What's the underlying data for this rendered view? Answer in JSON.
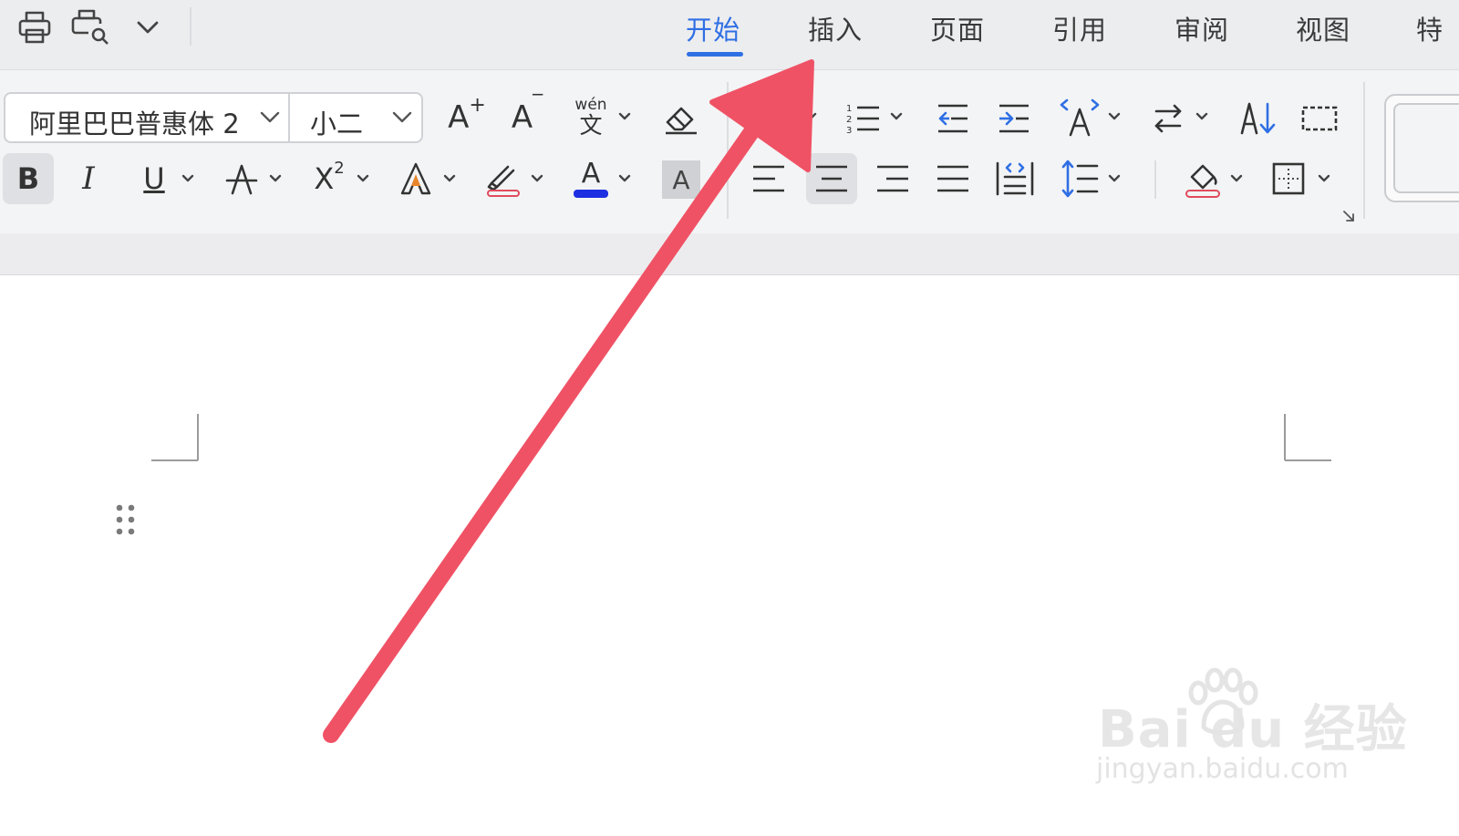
{
  "quick_access": {
    "print_icon": "printer-icon",
    "preview_icon": "print-preview-icon",
    "more_icon": "chevron-down-icon"
  },
  "tabs": [
    {
      "label": "开始",
      "active": true
    },
    {
      "label": "插入",
      "active": false
    },
    {
      "label": "页面",
      "active": false
    },
    {
      "label": "引用",
      "active": false
    },
    {
      "label": "审阅",
      "active": false
    },
    {
      "label": "视图",
      "active": false
    },
    {
      "label": "特",
      "active": false
    }
  ],
  "font": {
    "name": "阿里巴巴普惠体 2",
    "size": "小二"
  },
  "format": {
    "bold": "B",
    "italic": "I",
    "underline": "U",
    "superscript": "X",
    "superscript_exp": "2",
    "font_color_letter": "A",
    "char_shading_letter": "A",
    "grow_font": "A",
    "shrink_font": "A",
    "text_effect_letter": "A",
    "phonetic": "wén"
  },
  "colors": {
    "accent": "#2f6fe4",
    "font_color_bar": "#1d2fe0",
    "arrow": "#f05265",
    "text_effect": "#e8862a"
  },
  "watermark": {
    "main": "Bai du 经验",
    "url": "jingyan.baidu.com"
  }
}
